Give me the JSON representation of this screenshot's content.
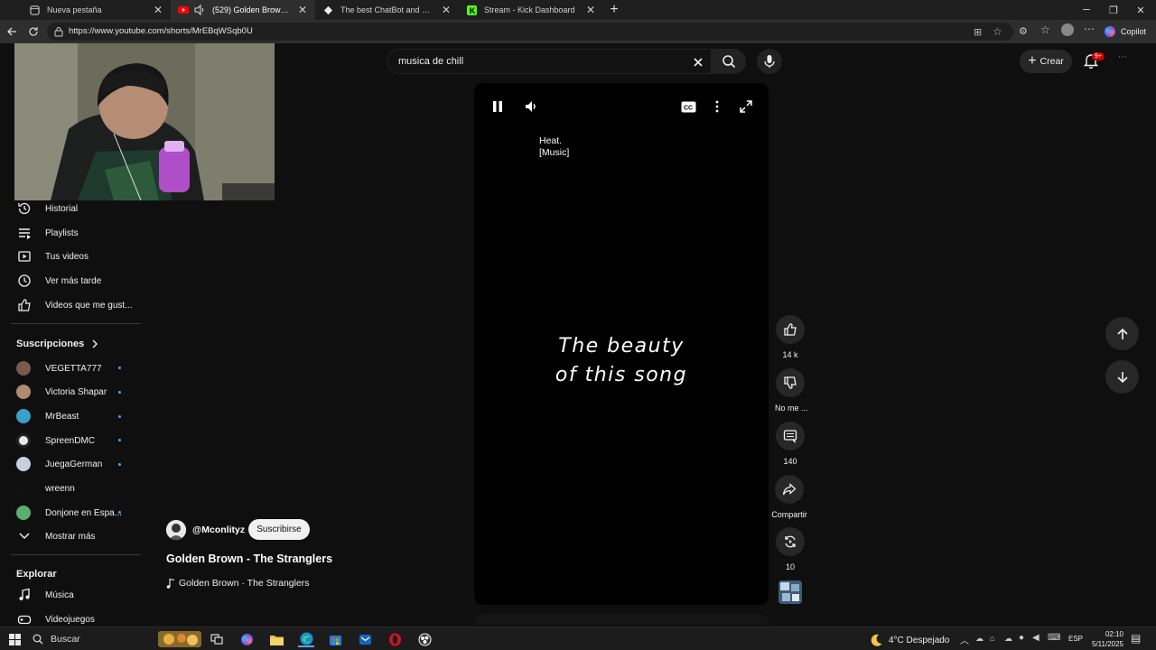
{
  "browser": {
    "tabs": [
      {
        "title": "Nueva pestaña",
        "active": false
      },
      {
        "title": "(529) Golden Brown - The Stranglers",
        "active": true
      },
      {
        "title": "The best ChatBot and Widgets for Kick",
        "active": false
      },
      {
        "title": "Stream - Kick Dashboard",
        "active": false
      }
    ],
    "url": "https://www.youtube.com/shorts/MrEBqWSqb0U",
    "copilot_label": "Copilot"
  },
  "header": {
    "search_value": "musica de chill",
    "create_label": "Crear",
    "notification_badge": "9+"
  },
  "sidebar": {
    "you_items": [
      {
        "label": "Historial",
        "icon": "history-icon"
      },
      {
        "label": "Playlists",
        "icon": "playlist-icon"
      },
      {
        "label": "Tus videos",
        "icon": "video-icon"
      },
      {
        "label": "Ver más tarde",
        "icon": "clock-icon"
      },
      {
        "label": "Videos que me gust...",
        "icon": "like-icon"
      }
    ],
    "subscriptions_title": "Suscripciones",
    "subscriptions": [
      {
        "label": "VEGETTA777",
        "color": "#7a5a48",
        "new": true
      },
      {
        "label": "Victoria Shapar",
        "color": "#b08a70",
        "new": true
      },
      {
        "label": "MrBeast",
        "color": "#3aa0c8",
        "new": true
      },
      {
        "label": "SpreenDMC",
        "color": "#e8e8e8",
        "new": true
      },
      {
        "label": "JuegaGerman",
        "color": "#c8d0e0",
        "new": true
      },
      {
        "label": "wreenn",
        "color": "#111111",
        "new": false
      },
      {
        "label": "Donjone en Espa...",
        "color": "#5ab070",
        "new": true
      }
    ],
    "show_more": "Mostrar más",
    "explore_title": "Explorar",
    "explore_items": [
      {
        "label": "Música",
        "icon": "music-icon"
      },
      {
        "label": "Videojuegos",
        "icon": "gamepad-icon"
      }
    ]
  },
  "player": {
    "caption_line1": "Heat.",
    "caption_line2": "[Music]",
    "overlay_line1": "The beauty",
    "overlay_line2": "of this song",
    "cc_label": "CC"
  },
  "actions": {
    "likes": "14 k",
    "dislike_label": "No me ...",
    "comments": "140",
    "share_label": "Compartir",
    "remix_count": "10"
  },
  "video": {
    "channel": "@Mconlityz",
    "subscribe_label": "Suscribirse",
    "title": "Golden Brown - The Stranglers",
    "music": "Golden Brown · The Stranglers"
  },
  "taskbar": {
    "search_label": "Buscar",
    "weather": "4°C  Despejado",
    "lang": "ESP",
    "time": "02:10",
    "date": "5/11/2025"
  }
}
